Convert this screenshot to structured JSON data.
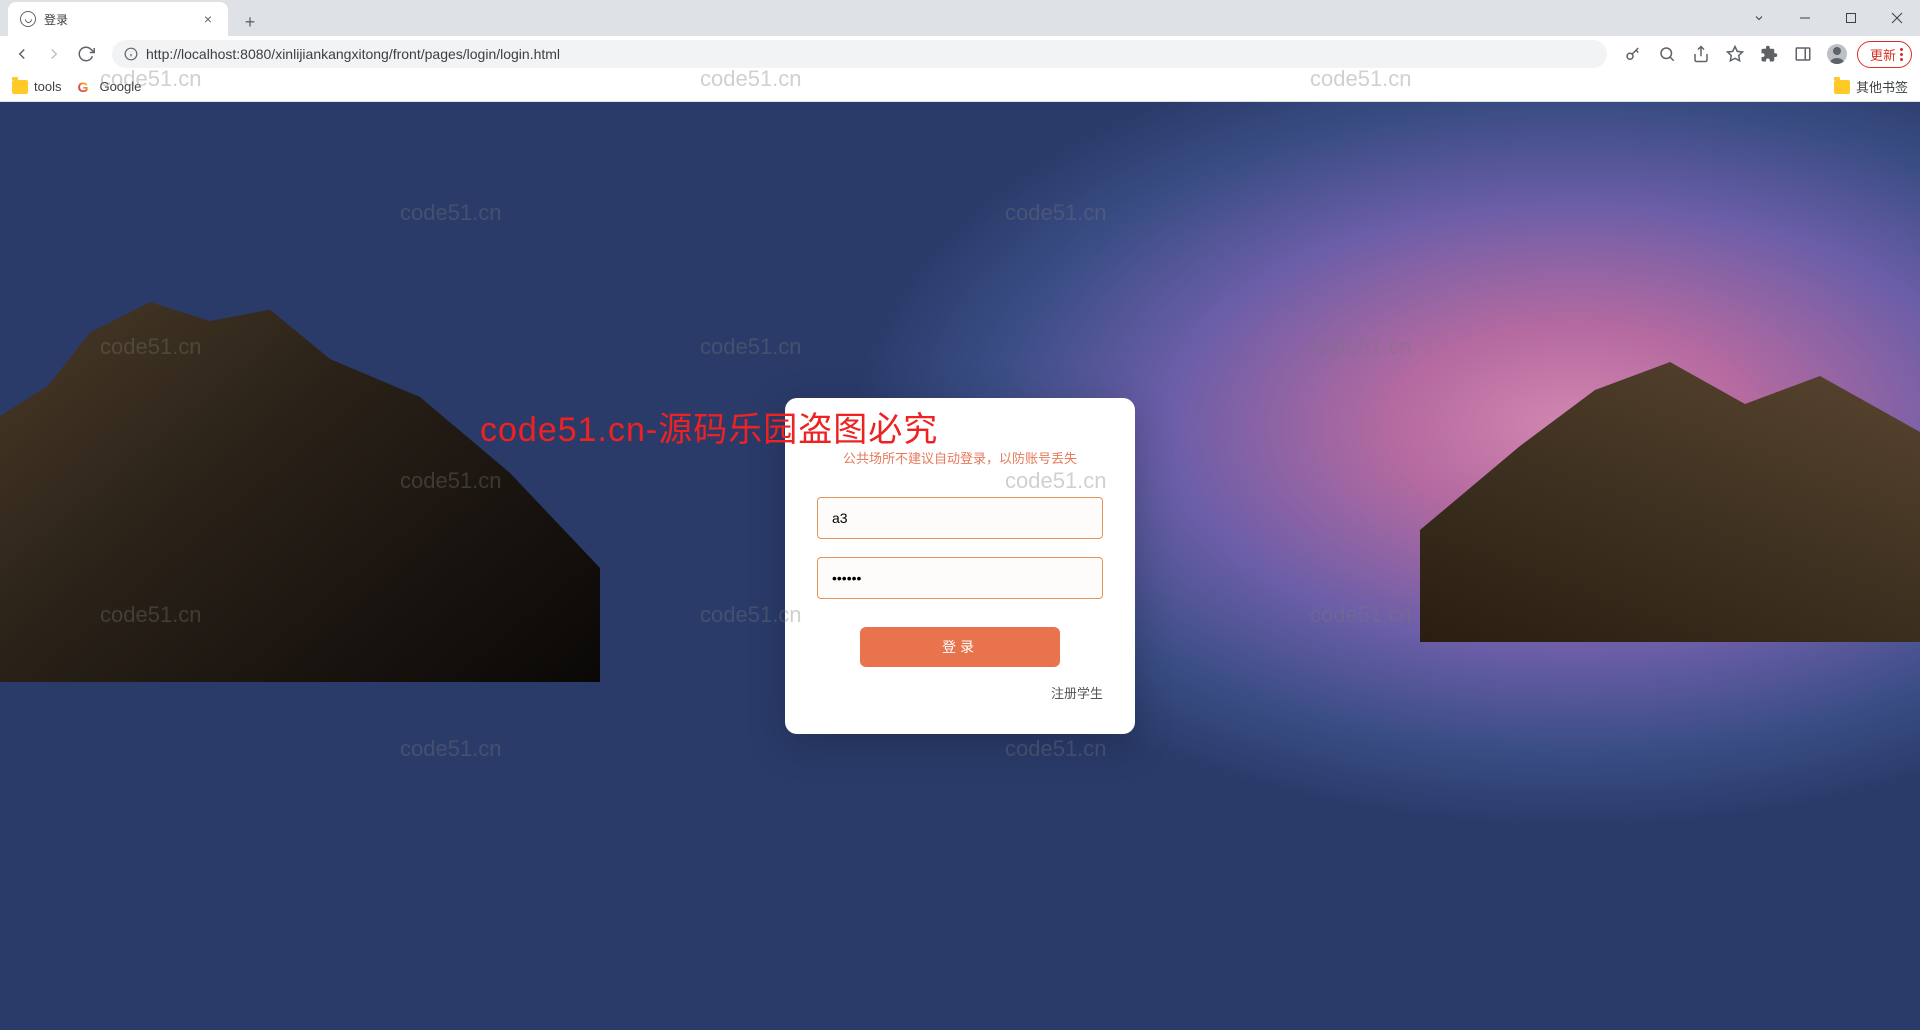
{
  "browser": {
    "tab_title": "登录",
    "url_display": "http://localhost:8080/xinlijiankangxitong/front/pages/login/login.html",
    "update_label": "更新",
    "bookmarks": {
      "tools": "tools",
      "google": "Google",
      "other": "其他书签"
    }
  },
  "login": {
    "hint": "公共场所不建议自动登录，以防账号丢失",
    "username_value": "a3",
    "password_value": "••••••",
    "login_button": "登录",
    "register_link": "注册学生"
  },
  "watermarks": {
    "domain": "code51.cn",
    "red": "code51.cn-源码乐园盗图必究"
  }
}
